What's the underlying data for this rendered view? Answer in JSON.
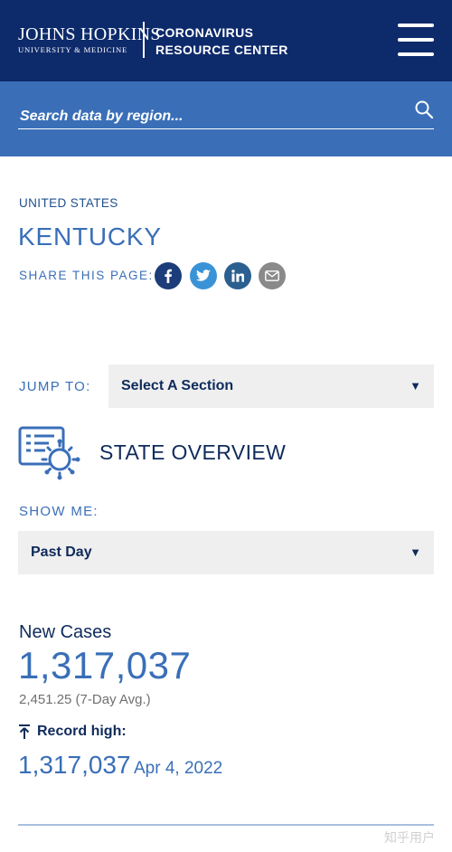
{
  "header": {
    "logo_name": "JOHNS HOPKINS",
    "logo_sub": "UNIVERSITY & MEDICINE",
    "site_title": "CORONAVIRUS RESOURCE CENTER",
    "menu_icon": "hamburger-menu-icon"
  },
  "search": {
    "placeholder": "Search data by region...",
    "icon": "search-icon"
  },
  "page": {
    "breadcrumb": "UNITED STATES",
    "title": "KENTUCKY",
    "share_label": "SHARE THIS PAGE:"
  },
  "share": [
    {
      "name": "facebook",
      "icon": "facebook-icon"
    },
    {
      "name": "twitter",
      "icon": "twitter-icon"
    },
    {
      "name": "linkedin",
      "icon": "linkedin-icon"
    },
    {
      "name": "email",
      "icon": "email-icon"
    }
  ],
  "jump": {
    "label": "JUMP TO:",
    "selected": "Select A Section"
  },
  "overview": {
    "title": "STATE OVERVIEW",
    "icon": "state-overview-icon"
  },
  "show_me": {
    "label": "SHOW ME:",
    "selected": "Past Day"
  },
  "stats": {
    "label": "New Cases",
    "value": "1,317,037",
    "avg": "2,451.25 (7-Day Avg.)",
    "record_label": "Record high:",
    "record_value": "1,317,037",
    "record_date": "Apr 4, 2022"
  },
  "watermark": "知乎用户",
  "colors": {
    "header_bg": "#0d2a6b",
    "search_bg": "#3a6fb8",
    "accent": "#3a6fb8",
    "text_dark": "#0f2b5b"
  }
}
